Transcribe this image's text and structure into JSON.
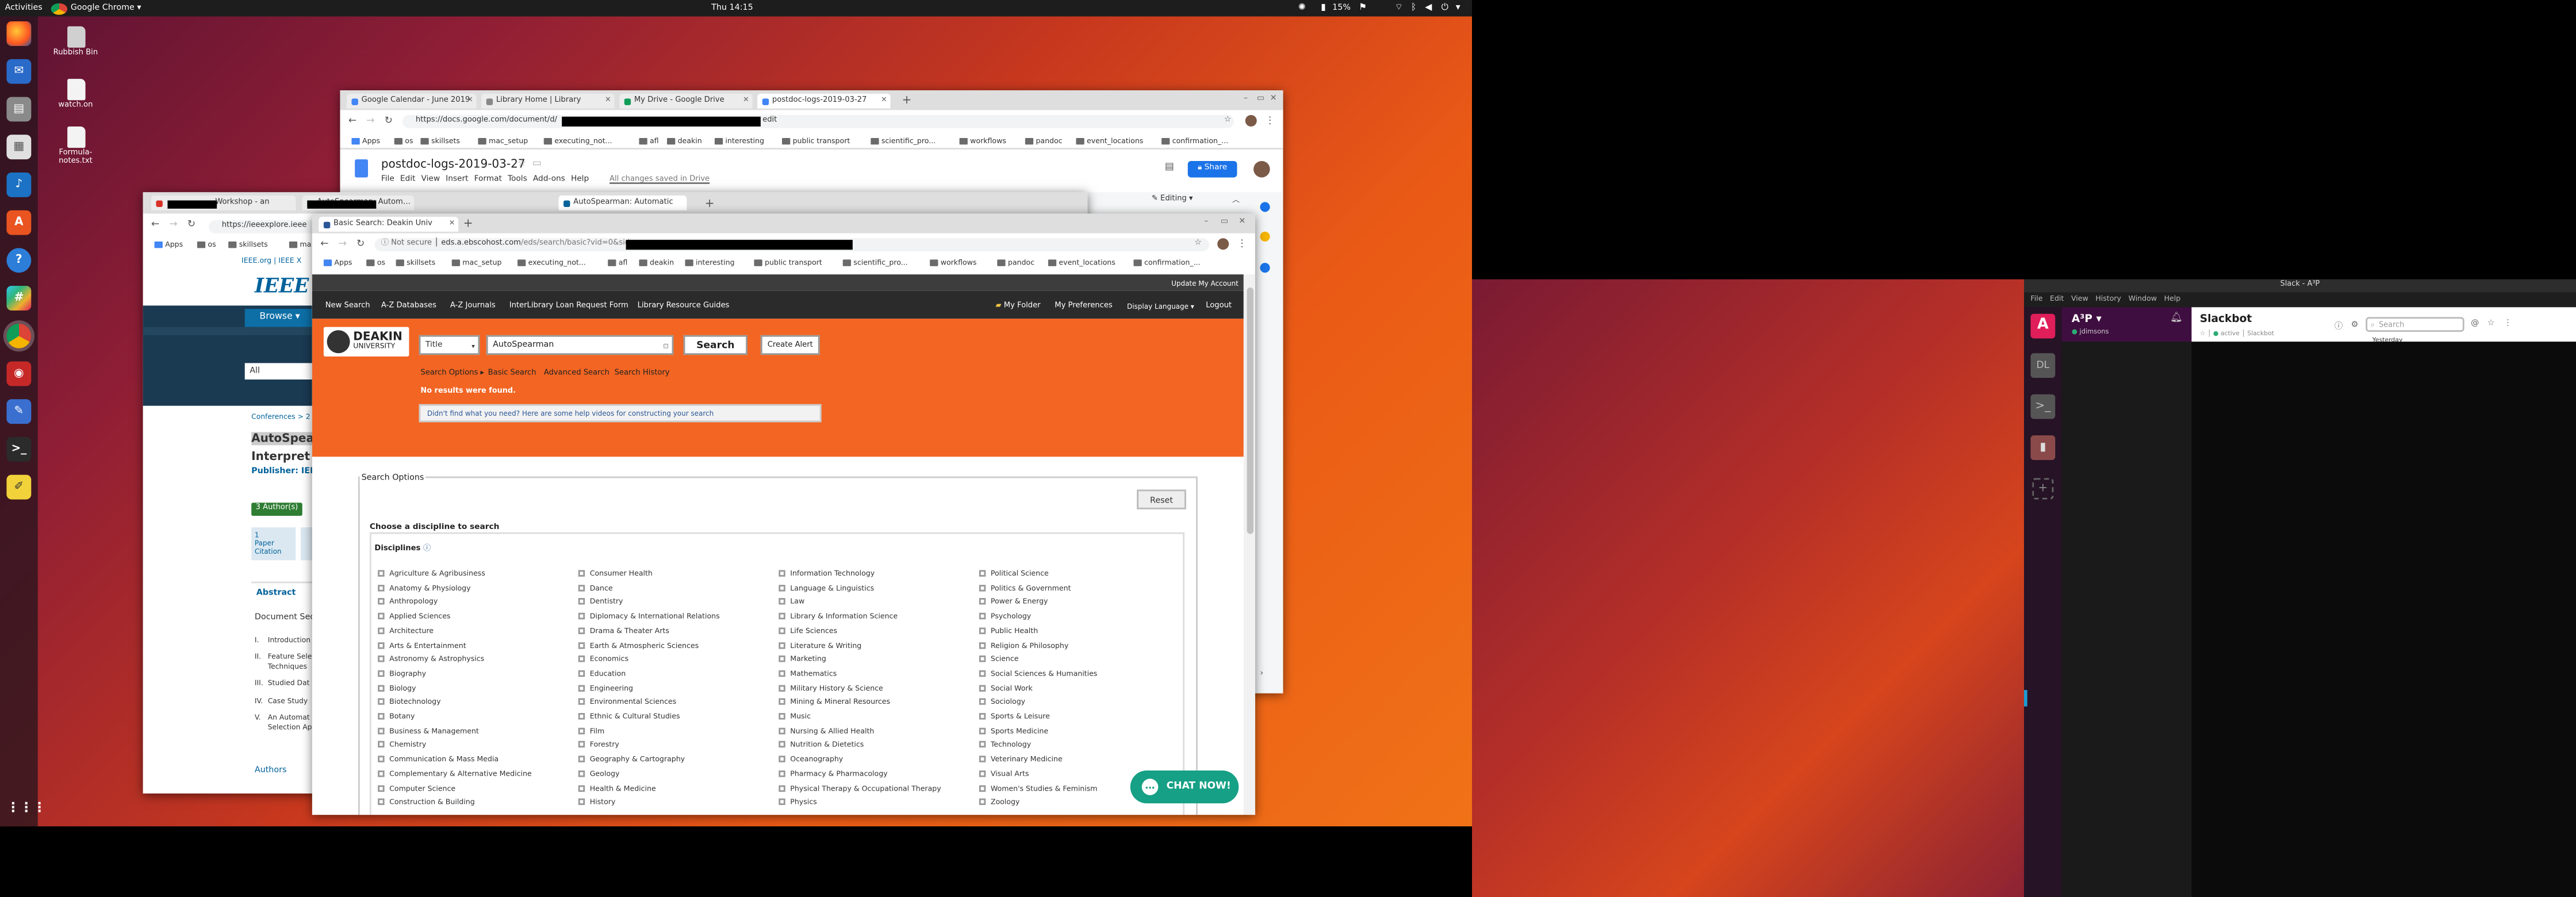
{
  "topbar": {
    "activities": "Activities",
    "app": "Google Chrome ▾",
    "clock": "Thu 14:15",
    "battery": "15%"
  },
  "desktop": {
    "icons": [
      "Rubbish Bin",
      "watch.on",
      "Formula-notes.txt"
    ]
  },
  "docs": {
    "tabs": [
      "Google Calendar - June 2019",
      "Library Home | Library",
      "My Drive - Google Drive",
      "postdoc-logs-2019-03-27"
    ],
    "url_prefix": "https://docs.google.com/document/d/",
    "url_suffix": "edit",
    "bookmarks": [
      "Apps",
      "os",
      "skillsets",
      "mac_setup",
      "executing_not...",
      "afl",
      "deakin",
      "interesting",
      "public transport",
      "scientific_pro...",
      "workflows",
      "pandoc",
      "event_locations",
      "confirmation_..."
    ],
    "title": "postdoc-logs-2019-03-27",
    "menu": [
      "File",
      "Edit",
      "View",
      "Insert",
      "Format",
      "Tools",
      "Add-ons",
      "Help"
    ],
    "saved": "All changes saved in Drive",
    "share": "Share",
    "editing": "Editing"
  },
  "ieee": {
    "tabs": [
      "Workshop - an",
      "AutoSpearman: Automatic",
      "AutoSpearman: Automatic"
    ],
    "url": "https://ieeexplore.ieee",
    "bookmarks": [
      "Apps",
      "os",
      "skillsets",
      "ma"
    ],
    "topline": "IEEE.org | IEEE X",
    "brand": "IEEE Xp",
    "browse": "Browse ▾",
    "all": "All",
    "crumb": "Conferences > 2",
    "title1": "AutoSpea",
    "title2": "Interpret",
    "publisher": "Publisher: IEE",
    "authors_badge": "3 Author(s)",
    "citation_count": "1",
    "citation_label1": "Paper",
    "citation_label2": "Citation",
    "abstract": "Abstract",
    "doc_sections": "Document Sec",
    "toc": [
      [
        "I.",
        "Introduction"
      ],
      [
        "II.",
        "Feature Sele"
      ],
      [
        "",
        "Techniques"
      ],
      [
        "III.",
        "Studied Dat"
      ],
      [
        "IV.",
        "Case Study"
      ],
      [
        "V.",
        "An Automat"
      ],
      [
        "",
        "Selection Ap"
      ]
    ],
    "authors": "Authors"
  },
  "ebsco": {
    "tab": "Basic Search: Deakin Univ",
    "not_secure": "Not secure",
    "url_host": "eds.a.ebscohost.com",
    "url_path": "/eds/search/basic?vid=0&sid=",
    "bookmarks": [
      "Apps",
      "os",
      "skillsets",
      "mac_setup",
      "executing_not...",
      "afl",
      "deakin",
      "interesting",
      "public transport",
      "scientific_pro...",
      "workflows",
      "pandoc",
      "event_locations",
      "confirmation_..."
    ],
    "update_account": "Update My Account",
    "nav": [
      "New Search",
      "A-Z Databases",
      "A-Z Journals",
      "InterLibrary Loan Request Form",
      "Library Resource Guides"
    ],
    "right_nav": [
      "My Folder",
      "My Preferences",
      "Display Language ▾",
      "Logout"
    ],
    "logo1": "DEAKIN",
    "logo2": "UNIVERSITY",
    "field_select": "Title",
    "query": "AutoSpearman",
    "search_btn": "Search",
    "alert_btn": "Create Alert",
    "links": [
      "Search Options ▸",
      "Basic Search",
      "Advanced Search",
      "Search History"
    ],
    "no_results": "No results were found.",
    "help_link": "Didn't find what you need? Here are some help videos for constructing your search",
    "options_title": "Search Options",
    "reset": "Reset",
    "discipline_heading": "Choose a discipline to search",
    "disciplines_label": "Disciplines",
    "cols": [
      [
        "Agriculture & Agribusiness",
        "Anatomy & Physiology",
        "Anthropology",
        "Applied Sciences",
        "Architecture",
        "Arts & Entertainment",
        "Astronomy & Astrophysics",
        "Biography",
        "Biology",
        "Biotechnology",
        "Botany",
        "Business & Management",
        "Chemistry",
        "Communication & Mass Media",
        "Complementary & Alternative Medicine",
        "Computer Science",
        "Construction & Building"
      ],
      [
        "Consumer Health",
        "Dance",
        "Dentistry",
        "Diplomacy & International Relations",
        "Drama & Theater Arts",
        "Earth & Atmospheric Sciences",
        "Economics",
        "Education",
        "Engineering",
        "Environmental Sciences",
        "Ethnic & Cultural Studies",
        "Film",
        "Forestry",
        "Geography & Cartography",
        "Geology",
        "Health & Medicine",
        "History"
      ],
      [
        "Information Technology",
        "Language & Linguistics",
        "Law",
        "Library & Information Science",
        "Life Sciences",
        "Literature & Writing",
        "Marketing",
        "Mathematics",
        "Military History & Science",
        "Mining & Mineral Resources",
        "Music",
        "Nursing & Allied Health",
        "Nutrition & Dietetics",
        "Oceanography",
        "Pharmacy & Pharmacology",
        "Physical Therapy & Occupational Therapy",
        "Physics"
      ],
      [
        "Political Science",
        "Politics & Government",
        "Power & Energy",
        "Psychology",
        "Public Health",
        "Religion & Philosophy",
        "Science",
        "Social Sciences & Humanities",
        "Social Work",
        "Sociology",
        "Sports & Leisure",
        "Sports Medicine",
        "Technology",
        "Veterinary Medicine",
        "Visual Arts",
        "Women's Studies & Feminism",
        "Zoology"
      ]
    ],
    "chat": "CHAT NOW!"
  },
  "slack": {
    "window_title": "Slack - A³P",
    "menu": [
      "File",
      "Edit",
      "View",
      "History",
      "Window",
      "Help"
    ],
    "workspace": "A³P",
    "user": "jdimsons",
    "channel": "Slackbot",
    "status": "active",
    "sub": "Slackbot",
    "search_placeholder": "Search",
    "ws_badges": [
      "A",
      "DL",
      "",
      ""
    ],
    "yesterday": "Yesterday"
  },
  "colors": {
    "ebsco_orange": "#f26522",
    "ebsco_dark": "#333333",
    "chat_green": "#16a085",
    "slack_sidebar": "#3f0e40",
    "ieee_blue": "#00629b"
  }
}
